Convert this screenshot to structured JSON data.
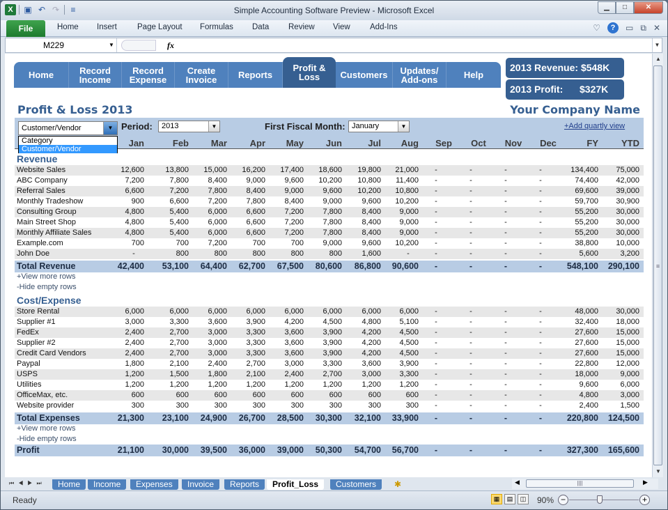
{
  "window": {
    "title": "Simple Accounting Software Preview  -  Microsoft Excel",
    "controls": [
      "minimize",
      "restore",
      "close"
    ]
  },
  "ribbon": {
    "file": "File",
    "tabs": [
      "Home",
      "Insert",
      "Page Layout",
      "Formulas",
      "Data",
      "Review",
      "View",
      "Add-Ins"
    ]
  },
  "formula_bar": {
    "name_box": "M229",
    "fx": "fx",
    "value": ""
  },
  "nav": {
    "items": [
      {
        "label": "Home",
        "active": false
      },
      {
        "label": "Record\nIncome",
        "active": false
      },
      {
        "label": "Record\nExpense",
        "active": false
      },
      {
        "label": "Create\nInvoice",
        "active": false
      },
      {
        "label": "Reports",
        "active": false
      },
      {
        "label": "Profit &\nLoss",
        "active": true
      },
      {
        "label": "Customers",
        "active": false
      },
      {
        "label": "Updates/\nAdd-ons",
        "active": false
      },
      {
        "label": "Help",
        "active": false
      }
    ]
  },
  "kpi": {
    "revenue": "2013 Revenue: $548K",
    "profit_label": "2013 Profit:",
    "profit_value": "$327K"
  },
  "report": {
    "title": "Profit & Loss 2013",
    "company": "Your Company Name",
    "group_by": {
      "value": "Customer/Vendor",
      "options": [
        "Category",
        "Customer/Vendor"
      ],
      "selected_option": "Customer/Vendor"
    },
    "period_label": "Period:",
    "period_value": "2013",
    "fiscal_label": "First Fiscal Month:",
    "fiscal_value": "January",
    "add_quarterly": "+Add quartly view",
    "columns": [
      "Jan",
      "Feb",
      "Mar",
      "Apr",
      "May",
      "Jun",
      "Jul",
      "Aug",
      "Sep",
      "Oct",
      "Nov",
      "Dec",
      "FY",
      "YTD"
    ],
    "revenue": {
      "heading": "Revenue",
      "rows": [
        {
          "label": "Website Sales",
          "values": [
            "12,600",
            "13,800",
            "15,000",
            "16,200",
            "17,400",
            "18,600",
            "19,800",
            "21,000",
            "-",
            "-",
            "-",
            "-",
            "134,400",
            "75,000"
          ]
        },
        {
          "label": "ABC Company",
          "values": [
            "7,200",
            "7,800",
            "8,400",
            "9,000",
            "9,600",
            "10,200",
            "10,800",
            "11,400",
            "-",
            "-",
            "-",
            "-",
            "74,400",
            "42,000"
          ]
        },
        {
          "label": "Referral Sales",
          "values": [
            "6,600",
            "7,200",
            "7,800",
            "8,400",
            "9,000",
            "9,600",
            "10,200",
            "10,800",
            "-",
            "-",
            "-",
            "-",
            "69,600",
            "39,000"
          ]
        },
        {
          "label": "Monthly Tradeshow",
          "values": [
            "900",
            "6,600",
            "7,200",
            "7,800",
            "8,400",
            "9,000",
            "9,600",
            "10,200",
            "-",
            "-",
            "-",
            "-",
            "59,700",
            "30,900"
          ]
        },
        {
          "label": "Consulting Group",
          "values": [
            "4,800",
            "5,400",
            "6,000",
            "6,600",
            "7,200",
            "7,800",
            "8,400",
            "9,000",
            "-",
            "-",
            "-",
            "-",
            "55,200",
            "30,000"
          ]
        },
        {
          "label": "Main Street Shop",
          "values": [
            "4,800",
            "5,400",
            "6,000",
            "6,600",
            "7,200",
            "7,800",
            "8,400",
            "9,000",
            "-",
            "-",
            "-",
            "-",
            "55,200",
            "30,000"
          ]
        },
        {
          "label": "Monthly Affiliate Sales",
          "values": [
            "4,800",
            "5,400",
            "6,000",
            "6,600",
            "7,200",
            "7,800",
            "8,400",
            "9,000",
            "-",
            "-",
            "-",
            "-",
            "55,200",
            "30,000"
          ]
        },
        {
          "label": "Example.com",
          "values": [
            "700",
            "700",
            "7,200",
            "700",
            "700",
            "9,000",
            "9,600",
            "10,200",
            "-",
            "-",
            "-",
            "-",
            "38,800",
            "10,000"
          ]
        },
        {
          "label": "John Doe",
          "values": [
            "-",
            "800",
            "800",
            "800",
            "800",
            "800",
            "1,600",
            "-",
            "-",
            "-",
            "-",
            "-",
            "5,600",
            "3,200"
          ]
        }
      ],
      "total": {
        "label": "Total Revenue",
        "values": [
          "42,400",
          "53,100",
          "64,400",
          "62,700",
          "67,500",
          "80,600",
          "86,800",
          "90,600",
          "-",
          "-",
          "-",
          "-",
          "548,100",
          "290,100"
        ]
      },
      "view_more": "+View more rows",
      "hide_empty": "-Hide empty rows"
    },
    "expense": {
      "heading": "Cost/Expense",
      "rows": [
        {
          "label": "Store Rental",
          "values": [
            "6,000",
            "6,000",
            "6,000",
            "6,000",
            "6,000",
            "6,000",
            "6,000",
            "6,000",
            "-",
            "-",
            "-",
            "-",
            "48,000",
            "30,000"
          ]
        },
        {
          "label": "Supplier #1",
          "values": [
            "3,000",
            "3,300",
            "3,600",
            "3,900",
            "4,200",
            "4,500",
            "4,800",
            "5,100",
            "-",
            "-",
            "-",
            "-",
            "32,400",
            "18,000"
          ]
        },
        {
          "label": "FedEx",
          "values": [
            "2,400",
            "2,700",
            "3,000",
            "3,300",
            "3,600",
            "3,900",
            "4,200",
            "4,500",
            "-",
            "-",
            "-",
            "-",
            "27,600",
            "15,000"
          ]
        },
        {
          "label": "Supplier #2",
          "values": [
            "2,400",
            "2,700",
            "3,000",
            "3,300",
            "3,600",
            "3,900",
            "4,200",
            "4,500",
            "-",
            "-",
            "-",
            "-",
            "27,600",
            "15,000"
          ]
        },
        {
          "label": "Credit Card Vendors",
          "values": [
            "2,400",
            "2,700",
            "3,000",
            "3,300",
            "3,600",
            "3,900",
            "4,200",
            "4,500",
            "-",
            "-",
            "-",
            "-",
            "27,600",
            "15,000"
          ]
        },
        {
          "label": "Paypal",
          "values": [
            "1,800",
            "2,100",
            "2,400",
            "2,700",
            "3,000",
            "3,300",
            "3,600",
            "3,900",
            "-",
            "-",
            "-",
            "-",
            "22,800",
            "12,000"
          ]
        },
        {
          "label": "USPS",
          "values": [
            "1,200",
            "1,500",
            "1,800",
            "2,100",
            "2,400",
            "2,700",
            "3,000",
            "3,300",
            "-",
            "-",
            "-",
            "-",
            "18,000",
            "9,000"
          ]
        },
        {
          "label": "Utilities",
          "values": [
            "1,200",
            "1,200",
            "1,200",
            "1,200",
            "1,200",
            "1,200",
            "1,200",
            "1,200",
            "-",
            "-",
            "-",
            "-",
            "9,600",
            "6,000"
          ]
        },
        {
          "label": "OfficeMax, etc.",
          "values": [
            "600",
            "600",
            "600",
            "600",
            "600",
            "600",
            "600",
            "600",
            "-",
            "-",
            "-",
            "-",
            "4,800",
            "3,000"
          ]
        },
        {
          "label": "Website provider",
          "values": [
            "300",
            "300",
            "300",
            "300",
            "300",
            "300",
            "300",
            "300",
            "-",
            "-",
            "-",
            "-",
            "2,400",
            "1,500"
          ]
        }
      ],
      "total": {
        "label": "Total Expenses",
        "values": [
          "21,300",
          "23,100",
          "24,900",
          "26,700",
          "28,500",
          "30,300",
          "32,100",
          "33,900",
          "-",
          "-",
          "-",
          "-",
          "220,800",
          "124,500"
        ]
      },
      "view_more": "+View more rows",
      "hide_empty": "-Hide empty rows"
    },
    "profit": {
      "label": "Profit",
      "values": [
        "21,100",
        "30,000",
        "39,500",
        "36,000",
        "39,000",
        "50,300",
        "54,700",
        "56,700",
        "-",
        "-",
        "-",
        "-",
        "327,300",
        "165,600"
      ]
    }
  },
  "sheet_tabs": {
    "tabs": [
      "Home",
      "Income",
      "Expenses",
      "Invoice",
      "Reports",
      "Profit_Loss",
      "Customers"
    ],
    "active": "Profit_Loss"
  },
  "status_bar": {
    "status": "Ready",
    "zoom": "90%",
    "zoom_level_percent": 90
  },
  "colors": {
    "nav_blue": "#4f81bd",
    "nav_active": "#365f91",
    "band": "#b8cce4",
    "title_blue": "#365f91"
  }
}
